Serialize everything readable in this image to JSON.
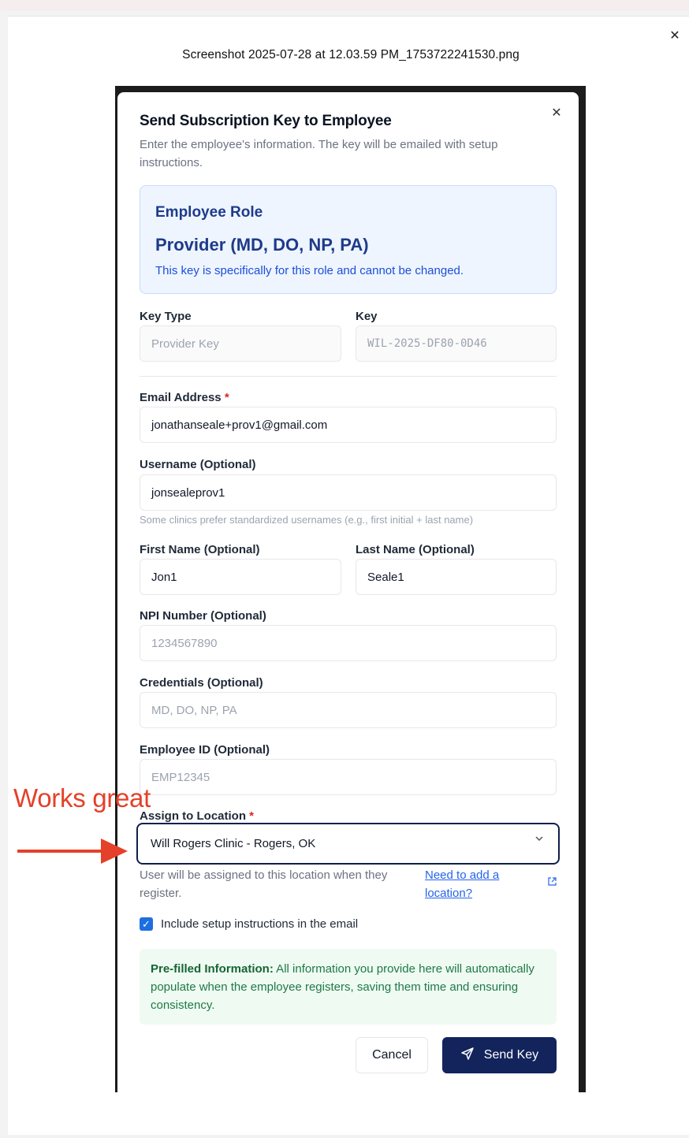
{
  "viewer": {
    "file_name": "Screenshot 2025-07-28 at 12.03.59 PM_1753722241530.png",
    "close_icon": "close-icon"
  },
  "dialog": {
    "title": "Send Subscription Key to Employee",
    "description": "Enter the employee's information. The key will be emailed with setup instructions.",
    "close_icon": "close-icon"
  },
  "role": {
    "label": "Employee Role",
    "value": "Provider (MD, DO, NP, PA)",
    "note": "This key is specifically for this role and cannot be changed."
  },
  "key_type": {
    "label": "Key Type",
    "value": "Provider Key"
  },
  "key": {
    "label": "Key",
    "value": "WIL-2025-DF80-0D46"
  },
  "email": {
    "label": "Email Address",
    "required_mark": "*",
    "value": "jonathanseale+prov1@gmail.com"
  },
  "username": {
    "label": "Username (Optional)",
    "value": "jonsealeprov1",
    "hint": "Some clinics prefer standardized usernames (e.g., first initial + last name)"
  },
  "first_name": {
    "label": "First Name (Optional)",
    "value": "Jon1"
  },
  "last_name": {
    "label": "Last Name (Optional)",
    "value": "Seale1"
  },
  "npi": {
    "label": "NPI Number (Optional)",
    "placeholder": "1234567890"
  },
  "credentials": {
    "label": "Credentials (Optional)",
    "placeholder": "MD, DO, NP, PA"
  },
  "employee_id": {
    "label": "Employee ID (Optional)",
    "placeholder": "EMP12345"
  },
  "location": {
    "label": "Assign to Location",
    "required_mark": "*",
    "selected": "Will Rogers Clinic - Rogers, OK",
    "help_line1": "User will be assigned to this location when they",
    "help_line2": "register.",
    "link_line1": "Need to add a",
    "link_line2": "location?",
    "link_icon": "external-link-icon"
  },
  "setup_instructions": {
    "label": "Include setup instructions in the email",
    "checked": true
  },
  "info": {
    "title": "Pre-filled Information:",
    "body": " All information you provide here will automatically populate when the employee registers, saving them time and ensuring consistency."
  },
  "actions": {
    "cancel": "Cancel",
    "send": "Send Key",
    "send_icon": "send-icon"
  },
  "annotation": {
    "text": "Works great",
    "color": "#e5402a"
  }
}
